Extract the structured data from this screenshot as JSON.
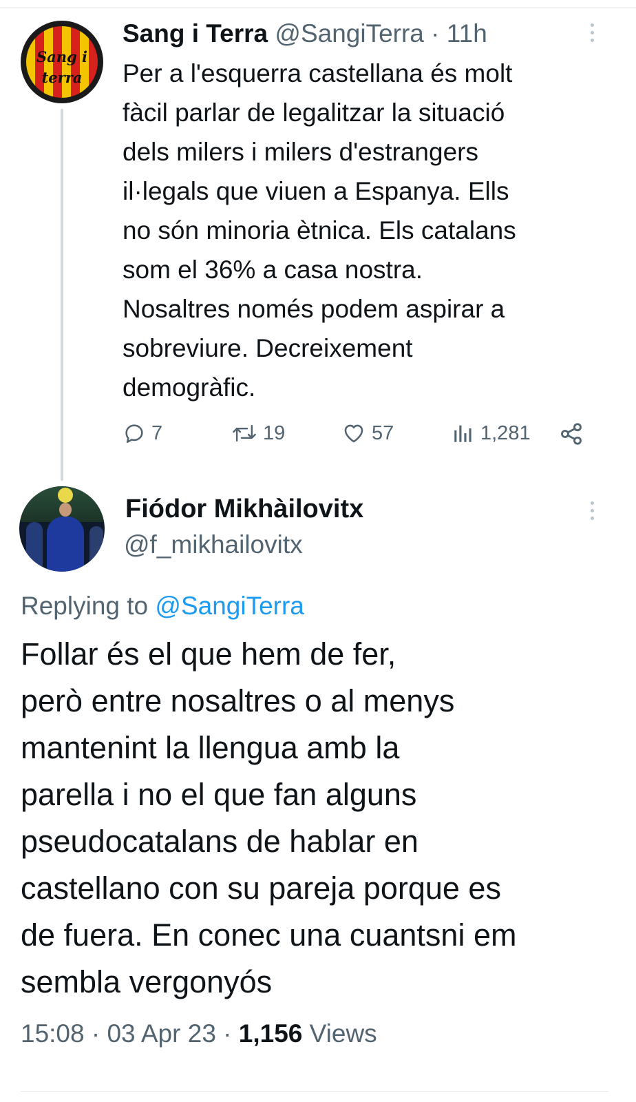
{
  "parent_tweet": {
    "avatar_text_line1": "Sang i",
    "avatar_text_line2": "terra",
    "display_name": "Sang i Terra",
    "handle": "@SangiTerra",
    "separator": "·",
    "time": "11h",
    "text": "Per a l'esquerra castellana és molt\nfàcil parlar de legalitzar la situació\ndels milers i milers d'estrangers\nil·legals que viuen a Espanya. Ells\nno són minoria ètnica. Els catalans\nsom el 36% a casa nostra.\nNosaltres només podem aspirar a\nsobreviure. Decreixement\ndemogràfic.",
    "replies": "7",
    "retweets": "19",
    "likes": "57",
    "views": "1,281",
    "icons": [
      "reply-icon",
      "retweet-icon",
      "like-icon",
      "views-icon",
      "share-icon",
      "more-icon"
    ]
  },
  "reply_tweet": {
    "display_name": "Fiódor Mikhàilovitx",
    "handle": "@f_mikhailovitx",
    "replying_prefix": "Replying to",
    "replying_mention": "@SangiTerra",
    "text": "Follar és el que hem de fer,\nperò entre nosaltres o al menys\nmantenint la llengua amb la\nparella i no el que fan alguns\npseudocatalans de hablar en\ncastellano con su pareja porque es\nde fuera. En conec una cuantsni em\nsembla vergonyós",
    "time": "15:08",
    "date": "03 Apr 23",
    "separator": "·",
    "views_count": "1,156",
    "views_label": "Views"
  },
  "colors": {
    "text_primary": "#0f1419",
    "text_secondary": "#536471",
    "link": "#1d9bf0",
    "divider": "#e6ecf0",
    "thread_line": "#cfd9de"
  }
}
